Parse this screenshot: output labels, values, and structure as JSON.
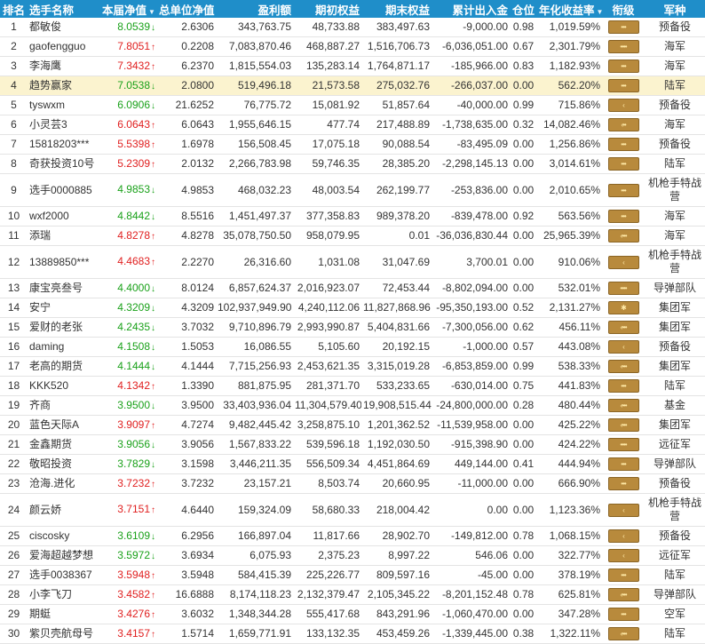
{
  "headers": {
    "rank": "排名",
    "name": "选手名称",
    "nav": "本届净值",
    "total_nav": "总单位净值",
    "profit": "盈利额",
    "start_equity": "期初权益",
    "end_equity": "期末权益",
    "net_flow": "累计出入金",
    "position": "仓位",
    "annual": "年化收益率",
    "level": "衔级",
    "army": "军种"
  },
  "colors": {
    "header_bg": "#1f8ec9",
    "up": "#e02020",
    "down": "#1aa11a",
    "highlight": "#fbf3cf",
    "badge": "#b88a3c"
  },
  "rows": [
    {
      "rank": "1",
      "name": "都敏俊",
      "nav": "8.0539",
      "dir": "down",
      "total": "2.6306",
      "profit": "343,763.75",
      "start": "48,733.88",
      "end": "383,497.63",
      "flow": "-9,000.00",
      "pos": "0.98",
      "annual": "1,019.59%",
      "badge": "•••",
      "army": "预备役"
    },
    {
      "rank": "2",
      "name": "gaofengguo",
      "nav": "7.8051",
      "dir": "up",
      "total": "0.2208",
      "profit": "7,083,870.46",
      "start": "468,887.27",
      "end": "1,516,706.73",
      "flow": "-6,036,051.00",
      "pos": "0.67",
      "annual": "2,301.79%",
      "badge": "••••",
      "army": "海军"
    },
    {
      "rank": "3",
      "name": "李海鹰",
      "nav": "7.3432",
      "dir": "up",
      "total": "6.2370",
      "profit": "1,815,554.03",
      "start": "135,283.14",
      "end": "1,764,871.17",
      "flow": "-185,966.00",
      "pos": "0.83",
      "annual": "1,182.93%",
      "badge": "•••",
      "army": "海军"
    },
    {
      "rank": "4",
      "name": "趋势赢家",
      "nav": "7.0538",
      "dir": "down",
      "total": "2.0800",
      "profit": "519,496.18",
      "start": "21,573.58",
      "end": "275,032.76",
      "flow": "-266,037.00",
      "pos": "0.00",
      "annual": "562.20%",
      "badge": "•••",
      "army": "陆军",
      "hl": true
    },
    {
      "rank": "5",
      "name": "tyswxm",
      "nav": "6.0906",
      "dir": "down",
      "total": "21.6252",
      "profit": "76,775.72",
      "start": "15,081.92",
      "end": "51,857.64",
      "flow": "-40,000.00",
      "pos": "0.99",
      "annual": "715.86%",
      "badge": "‹",
      "army": "预备役"
    },
    {
      "rank": "6",
      "name": "小灵芸3",
      "nav": "6.0643",
      "dir": "up",
      "total": "6.0643",
      "profit": "1,955,646.15",
      "start": "477.74",
      "end": "217,488.89",
      "flow": "-1,738,635.00",
      "pos": "0.32",
      "annual": "14,082.46%",
      "badge": "‹••",
      "army": "海军"
    },
    {
      "rank": "7",
      "name": "15818203***",
      "nav": "5.5398",
      "dir": "up",
      "total": "1.6978",
      "profit": "156,508.45",
      "start": "17,075.18",
      "end": "90,088.54",
      "flow": "-83,495.09",
      "pos": "0.00",
      "annual": "1,256.86%",
      "badge": "•••",
      "army": "预备役"
    },
    {
      "rank": "8",
      "name": "奇获投资10号",
      "nav": "5.2309",
      "dir": "up",
      "total": "2.0132",
      "profit": "2,266,783.98",
      "start": "59,746.35",
      "end": "28,385.20",
      "flow": "-2,298,145.13",
      "pos": "0.00",
      "annual": "3,014.61%",
      "badge": "•••",
      "army": "陆军"
    },
    {
      "rank": "9",
      "name": "选手0000885",
      "nav": "4.9853",
      "dir": "down",
      "total": "4.9853",
      "profit": "468,032.23",
      "start": "48,003.54",
      "end": "262,199.77",
      "flow": "-253,836.00",
      "pos": "0.00",
      "annual": "2,010.65%",
      "badge": "•••",
      "army": "机枪手特战营",
      "tall": true
    },
    {
      "rank": "10",
      "name": "wxf2000",
      "nav": "4.8442",
      "dir": "down",
      "total": "8.5516",
      "profit": "1,451,497.37",
      "start": "377,358.83",
      "end": "989,378.20",
      "flow": "-839,478.00",
      "pos": "0.92",
      "annual": "563.56%",
      "badge": "•••",
      "army": "海军"
    },
    {
      "rank": "11",
      "name": "添瑞",
      "nav": "4.8278",
      "dir": "up",
      "total": "4.8278",
      "profit": "35,078,750.50",
      "start": "958,079.95",
      "end": "0.01",
      "flow": "-36,036,830.44",
      "pos": "0.00",
      "annual": "25,965.39%",
      "badge": "‹•••",
      "army": "海军"
    },
    {
      "rank": "12",
      "name": "13889850***",
      "nav": "4.4683",
      "dir": "up",
      "total": "2.2270",
      "profit": "26,316.60",
      "start": "1,031.08",
      "end": "31,047.69",
      "flow": "3,700.01",
      "pos": "0.00",
      "annual": "910.06%",
      "badge": "‹",
      "army": "机枪手特战营",
      "tall": true
    },
    {
      "rank": "13",
      "name": "康宝亮叁号",
      "nav": "4.4000",
      "dir": "down",
      "total": "8.0124",
      "profit": "6,857,624.37",
      "start": "2,016,923.07",
      "end": "72,453.44",
      "flow": "-8,802,094.00",
      "pos": "0.00",
      "annual": "532.01%",
      "badge": "••••",
      "army": "导弹部队"
    },
    {
      "rank": "14",
      "name": "安宁",
      "nav": "4.3209",
      "dir": "down",
      "total": "4.3209",
      "profit": "102,937,949.90",
      "start": "4,240,112.06",
      "end": "11,827,868.96",
      "flow": "-95,350,193.00",
      "pos": "0.52",
      "annual": "2,131.27%",
      "badge": "✱",
      "army": "集团军"
    },
    {
      "rank": "15",
      "name": "爱财的老张",
      "nav": "4.2435",
      "dir": "down",
      "total": "3.7032",
      "profit": "9,710,896.79",
      "start": "2,993,990.87",
      "end": "5,404,831.66",
      "flow": "-7,300,056.00",
      "pos": "0.62",
      "annual": "456.11%",
      "badge": "‹•••",
      "army": "集团军"
    },
    {
      "rank": "16",
      "name": "daming",
      "nav": "4.1508",
      "dir": "down",
      "total": "1.5053",
      "profit": "16,086.55",
      "start": "5,105.60",
      "end": "20,192.15",
      "flow": "-1,000.00",
      "pos": "0.57",
      "annual": "443.08%",
      "badge": "‹",
      "army": "预备役"
    },
    {
      "rank": "17",
      "name": "老高的期货",
      "nav": "4.1444",
      "dir": "down",
      "total": "4.1444",
      "profit": "7,715,256.93",
      "start": "2,453,621.35",
      "end": "3,315,019.28",
      "flow": "-6,853,859.00",
      "pos": "0.99",
      "annual": "538.33%",
      "badge": "‹•••",
      "army": "集团军"
    },
    {
      "rank": "18",
      "name": "KKK520",
      "nav": "4.1342",
      "dir": "up",
      "total": "1.3390",
      "profit": "881,875.95",
      "start": "281,371.70",
      "end": "533,233.65",
      "flow": "-630,014.00",
      "pos": "0.75",
      "annual": "441.83%",
      "badge": "•••",
      "army": "陆军"
    },
    {
      "rank": "19",
      "name": "齐商",
      "nav": "3.9500",
      "dir": "down",
      "total": "3.9500",
      "profit": "33,403,936.04",
      "start": "11,304,579.40",
      "end": "19,908,515.44",
      "flow": "-24,800,000.00",
      "pos": "0.28",
      "annual": "480.44%",
      "badge": "‹•••",
      "army": "基金"
    },
    {
      "rank": "20",
      "name": "蓝色天际A",
      "nav": "3.9097",
      "dir": "up",
      "total": "4.7274",
      "profit": "9,482,445.42",
      "start": "3,258,875.10",
      "end": "1,201,362.52",
      "flow": "-11,539,958.00",
      "pos": "0.00",
      "annual": "425.22%",
      "badge": "‹•••",
      "army": "集团军"
    },
    {
      "rank": "21",
      "name": "金鑫期货",
      "nav": "3.9056",
      "dir": "down",
      "total": "3.9056",
      "profit": "1,567,833.22",
      "start": "539,596.18",
      "end": "1,192,030.50",
      "flow": "-915,398.90",
      "pos": "0.00",
      "annual": "424.22%",
      "badge": "••••",
      "army": "远征军"
    },
    {
      "rank": "22",
      "name": "敬昭投资",
      "nav": "3.7829",
      "dir": "down",
      "total": "3.1598",
      "profit": "3,446,211.35",
      "start": "556,509.34",
      "end": "4,451,864.69",
      "flow": "449,144.00",
      "pos": "0.41",
      "annual": "444.94%",
      "badge": "•••",
      "army": "导弹部队"
    },
    {
      "rank": "23",
      "name": "沧海.进化",
      "nav": "3.7232",
      "dir": "up",
      "total": "3.7232",
      "profit": "23,157.21",
      "start": "8,503.74",
      "end": "20,660.95",
      "flow": "-11,000.00",
      "pos": "0.00",
      "annual": "666.90%",
      "badge": "•••",
      "army": "预备役"
    },
    {
      "rank": "24",
      "name": "颜云娇",
      "nav": "3.7151",
      "dir": "up",
      "total": "4.6440",
      "profit": "159,324.09",
      "start": "58,680.33",
      "end": "218,004.42",
      "flow": "0.00",
      "pos": "0.00",
      "annual": "1,123.36%",
      "badge": "‹",
      "army": "机枪手特战营",
      "tall": true
    },
    {
      "rank": "25",
      "name": "ciscosky",
      "nav": "3.6109",
      "dir": "down",
      "total": "6.2956",
      "profit": "166,897.04",
      "start": "11,817.66",
      "end": "28,902.70",
      "flow": "-149,812.00",
      "pos": "0.78",
      "annual": "1,068.15%",
      "badge": "‹",
      "army": "预备役"
    },
    {
      "rank": "26",
      "name": "爱海超越梦想",
      "nav": "3.5972",
      "dir": "down",
      "total": "3.6934",
      "profit": "6,075.93",
      "start": "2,375.23",
      "end": "8,997.22",
      "flow": "546.06",
      "pos": "0.00",
      "annual": "322.77%",
      "badge": "‹",
      "army": "远征军"
    },
    {
      "rank": "27",
      "name": "选手0038367",
      "nav": "3.5948",
      "dir": "up",
      "total": "3.5948",
      "profit": "584,415.39",
      "start": "225,226.77",
      "end": "809,597.16",
      "flow": "-45.00",
      "pos": "0.00",
      "annual": "378.19%",
      "badge": "•••",
      "army": "陆军"
    },
    {
      "rank": "28",
      "name": "小李飞刀",
      "nav": "3.4582",
      "dir": "up",
      "total": "16.6888",
      "profit": "8,174,118.23",
      "start": "2,132,379.47",
      "end": "2,105,345.22",
      "flow": "-8,201,152.48",
      "pos": "0.78",
      "annual": "625.81%",
      "badge": "‹•••",
      "army": "导弹部队"
    },
    {
      "rank": "29",
      "name": "期蜓",
      "nav": "3.4276",
      "dir": "up",
      "total": "3.6032",
      "profit": "1,348,344.28",
      "start": "555,417.68",
      "end": "843,291.96",
      "flow": "-1,060,470.00",
      "pos": "0.00",
      "annual": "347.28%",
      "badge": "•••",
      "army": "空军"
    },
    {
      "rank": "30",
      "name": "紫贝壳航母号",
      "nav": "3.4157",
      "dir": "up",
      "total": "1.5714",
      "profit": "1,659,771.91",
      "start": "133,132.35",
      "end": "453,459.26",
      "flow": "-1,339,445.00",
      "pos": "0.38",
      "annual": "1,322.11%",
      "badge": "‹•••",
      "army": "陆军"
    }
  ]
}
